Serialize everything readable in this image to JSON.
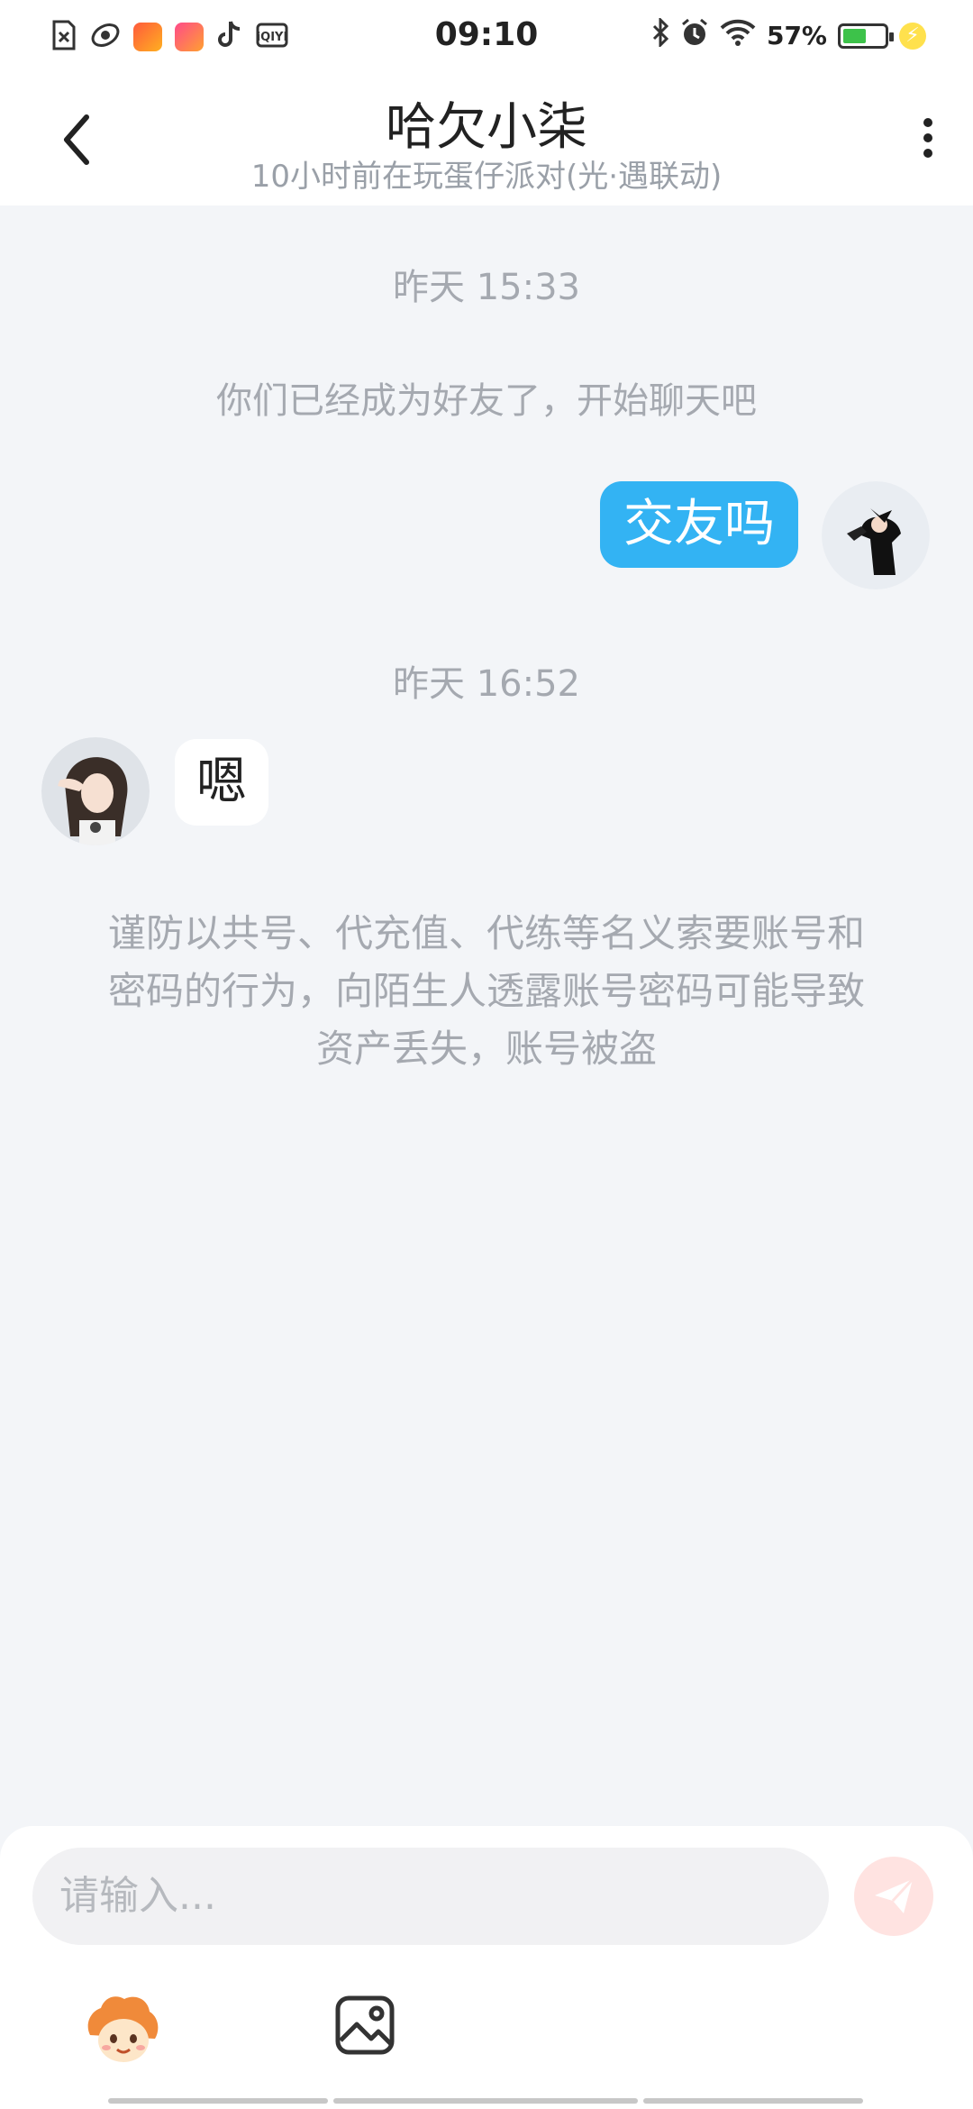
{
  "status_bar": {
    "time": "09:10",
    "battery_percent": "57%",
    "battery_level": 0.57,
    "icons": [
      "sim-off-icon",
      "app-icon",
      "kuaishou-icon",
      "kuaishou-icon",
      "tiktok-icon",
      "iqiyi-icon",
      "bluetooth-icon",
      "alarm-icon",
      "wifi-icon",
      "battery-icon",
      "charging-icon"
    ]
  },
  "header": {
    "title": "哈欠小柒",
    "subtitle": "10小时前在玩蛋仔派对(光·遇联动)"
  },
  "chat": {
    "timestamp_1": "昨天 15:33",
    "friend_notice": "你们已经成为好友了，开始聊天吧",
    "outgoing_message": "交友吗",
    "timestamp_2": "昨天 16:52",
    "incoming_message": "嗯",
    "warning_line_1": "谨防以共号、代充值、代练等名义索要账号和",
    "warning_line_2": "密码的行为，向陌生人透露账号密码可能导致",
    "warning_line_3": "资产丢失，账号被盗"
  },
  "composer": {
    "placeholder": "请输入..."
  },
  "colors": {
    "accent_blue": "#33b3f3",
    "send_button": "#ffe3e1",
    "background": "#f3f5f8"
  }
}
